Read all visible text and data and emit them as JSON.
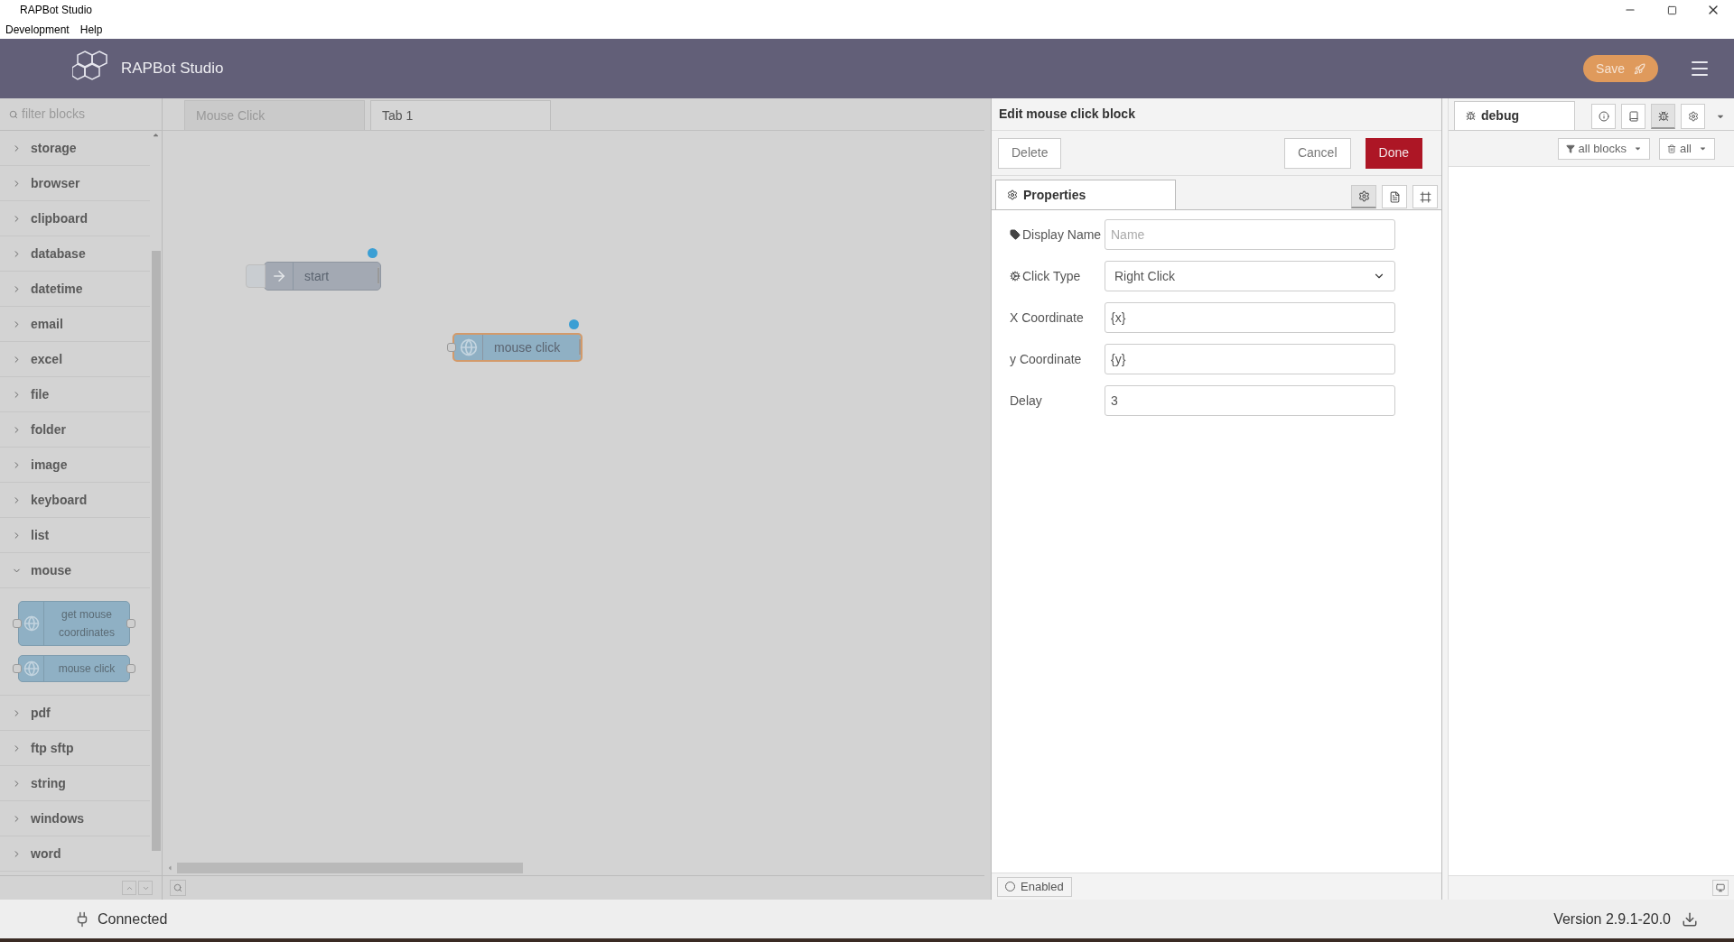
{
  "window": {
    "title": "RAPBot Studio"
  },
  "menu": [
    {
      "label": "Development"
    },
    {
      "label": "Help"
    }
  ],
  "header": {
    "app_name": "RAPBot Studio",
    "save_label": "Save"
  },
  "palette": {
    "filter_placeholder": "filter blocks",
    "categories": [
      {
        "label": "storage",
        "expanded": false
      },
      {
        "label": "browser",
        "expanded": false
      },
      {
        "label": "clipboard",
        "expanded": false
      },
      {
        "label": "database",
        "expanded": false
      },
      {
        "label": "datetime",
        "expanded": false
      },
      {
        "label": "email",
        "expanded": false
      },
      {
        "label": "excel",
        "expanded": false
      },
      {
        "label": "file",
        "expanded": false
      },
      {
        "label": "folder",
        "expanded": false
      },
      {
        "label": "image",
        "expanded": false
      },
      {
        "label": "keyboard",
        "expanded": false
      },
      {
        "label": "list",
        "expanded": false
      },
      {
        "label": "mouse",
        "expanded": true,
        "blocks": [
          {
            "label": "get mouse coordinates"
          },
          {
            "label": "mouse click"
          }
        ]
      },
      {
        "label": "pdf",
        "expanded": false
      },
      {
        "label": "ftp sftp",
        "expanded": false
      },
      {
        "label": "string",
        "expanded": false
      },
      {
        "label": "windows",
        "expanded": false
      },
      {
        "label": "word",
        "expanded": false
      }
    ]
  },
  "workspace": {
    "tabs": [
      {
        "label": "Mouse Click",
        "selected": false
      },
      {
        "label": "Tab 1",
        "selected": true
      }
    ],
    "nodes": [
      {
        "label": "start",
        "kind": "trigger",
        "selected": false,
        "changed": true
      },
      {
        "label": "mouse click",
        "kind": "action",
        "selected": true,
        "changed": true
      }
    ]
  },
  "editor": {
    "title": "Edit mouse click block",
    "delete_label": "Delete",
    "cancel_label": "Cancel",
    "done_label": "Done",
    "tab": {
      "label": "Properties",
      "selected": true
    },
    "view_buttons": [
      {
        "kind": "settings",
        "selected": true
      },
      {
        "kind": "description",
        "selected": false
      },
      {
        "kind": "appearance",
        "selected": false
      }
    ],
    "fields": [
      {
        "label": "Display Name",
        "kind": "text",
        "placeholder": "Name"
      },
      {
        "label": "Click Type",
        "kind": "select",
        "value": "Right Click"
      },
      {
        "label": "X Coordinate",
        "kind": "text",
        "value": "{x}"
      },
      {
        "label": "y Coordinate",
        "kind": "text",
        "value": "{y}"
      },
      {
        "label": "Delay",
        "kind": "text",
        "value": "3"
      }
    ],
    "enabled": {
      "label": "Enabled",
      "on": false
    }
  },
  "sidebar": {
    "tab": {
      "label": "debug",
      "selected": true
    },
    "tool_buttons": [
      {
        "kind": "info",
        "selected": false
      },
      {
        "kind": "help",
        "selected": false
      },
      {
        "kind": "debug",
        "selected": true
      },
      {
        "kind": "config",
        "selected": false
      }
    ],
    "filter_label": "all blocks",
    "clear_label": "all"
  },
  "status_bar": {
    "connection": "Connected",
    "version": "Version 2.9.1-20.0"
  }
}
